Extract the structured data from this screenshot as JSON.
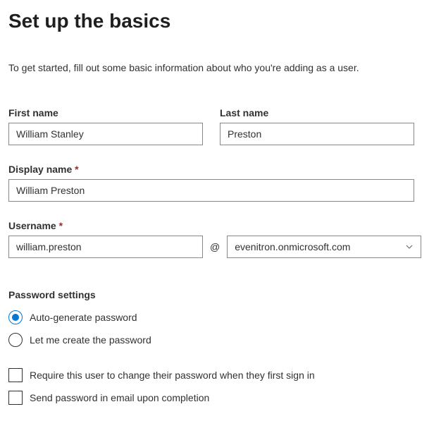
{
  "title": "Set up the basics",
  "intro": "To get started, fill out some basic information about who you're adding as a user.",
  "first_name": {
    "label": "First name",
    "value": "William Stanley"
  },
  "last_name": {
    "label": "Last name",
    "value": "Preston"
  },
  "display_name": {
    "label": "Display name",
    "required": "*",
    "value": "William Preston"
  },
  "username": {
    "label": "Username",
    "required": "*",
    "value": "william.preston",
    "at": "@",
    "domain": "evenitron.onmicrosoft.com"
  },
  "password": {
    "section_label": "Password settings",
    "auto": "Auto-generate password",
    "manual": "Let me create the password",
    "require_change": "Require this user to change their password when they first sign in",
    "send_email": "Send password in email upon completion"
  }
}
